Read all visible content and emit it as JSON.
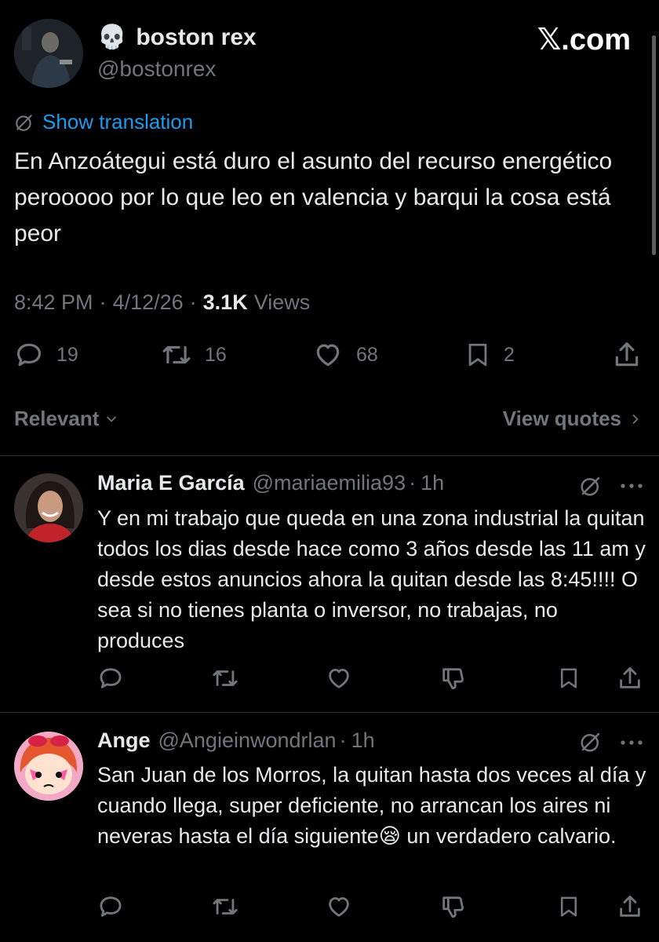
{
  "scroll_position": 0.2,
  "tweet": {
    "display_name": "boston rex",
    "name_emoji": "💀",
    "handle": "@bostonrex",
    "site_label": "𝕏.com",
    "show_translation": "Show translation",
    "text": "En Anzoátegui está duro el asunto del recurso energético perooooo por lo que leo en valencia y barqui la cosa está peor",
    "time": "8:42 PM",
    "sep": "·",
    "date": "4/12/26",
    "views_count": "3.1K",
    "views_label": "Views",
    "replies": "19",
    "reposts": "16",
    "likes": "68",
    "bookmarks": "2"
  },
  "sort": {
    "label": "Relevant",
    "view_quotes": "View quotes"
  },
  "replies": [
    {
      "name": "Maria E García",
      "handle": "@mariaemilia93",
      "sep": "·",
      "time": "1h",
      "text": "Y en mi trabajo que queda en una zona industrial la quitan todos los dias desde hace como 3 años desde las 11 am y desde estos anuncios ahora la quitan desde las 8:45!!!! O sea si no tienes planta o inversor, no trabajas, no produces"
    },
    {
      "name": "Ange",
      "handle": "@Angieinwondrlan",
      "sep": "·",
      "time": "1h",
      "text": "San Juan de los Morros, la quitan hasta dos veces al día y cuando llega, super deficiente, no arrancan los aires ni neveras hasta el día siguiente😪 un verdadero calvario."
    }
  ]
}
